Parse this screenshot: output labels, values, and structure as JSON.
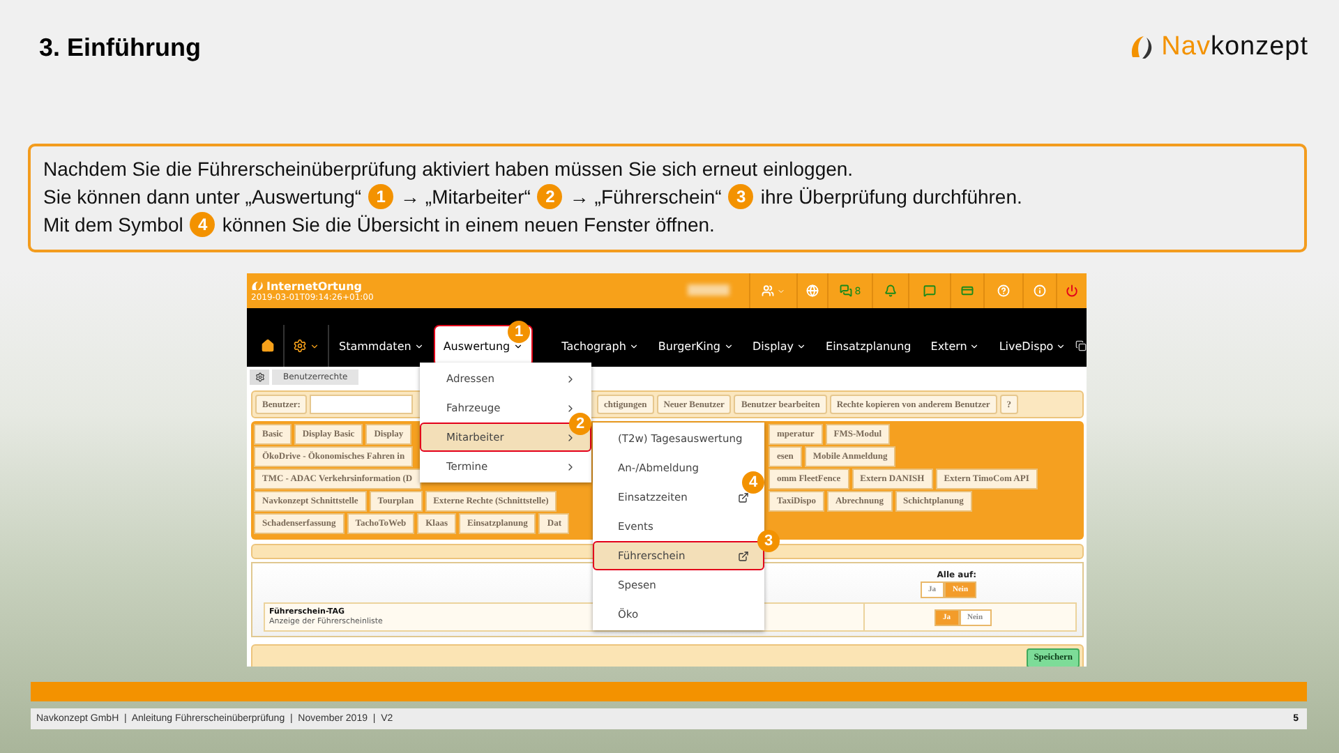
{
  "slide": {
    "title": "3. Einführung",
    "logo": {
      "prefix": "Nav",
      "suffix": "konzept"
    }
  },
  "instructions": [
    {
      "segments": [
        {
          "kind": "text",
          "text": "Nachdem Sie die Führerscheinüberprüfung aktiviert haben müssen Sie sich erneut einloggen."
        }
      ]
    },
    {
      "segments": [
        {
          "kind": "text",
          "text": "Sie können dann unter „Auswertung“"
        },
        {
          "kind": "badge",
          "text": "1"
        },
        {
          "kind": "text",
          "text": "→ „Mitarbeiter“"
        },
        {
          "kind": "badge",
          "text": "2"
        },
        {
          "kind": "text",
          "text": "→ „Führerschein“"
        },
        {
          "kind": "badge",
          "text": "3"
        },
        {
          "kind": "text",
          "text": "ihre Überprüfung durchführen."
        }
      ]
    },
    {
      "segments": [
        {
          "kind": "text",
          "text": "Mit dem Symbol"
        },
        {
          "kind": "badge",
          "text": "4"
        },
        {
          "kind": "text",
          "text": "können Sie die Übersicht in einem neuen Fenster öffnen."
        }
      ]
    }
  ],
  "app": {
    "brand": "InternetOrtung",
    "timestamp": "2019-03-01T09:14:26+01:00",
    "message_count": "8",
    "nav": [
      {
        "label": "Stammdaten",
        "caret": true,
        "selected": false
      },
      {
        "label": "Auswertung",
        "caret": true,
        "selected": true
      },
      {
        "label": "Tachograph",
        "caret": true,
        "selected": false
      },
      {
        "label": "BurgerKing",
        "caret": true,
        "selected": false
      },
      {
        "label": "Display",
        "caret": true,
        "selected": false
      },
      {
        "label": "Einsatzplanung",
        "caret": false,
        "selected": false
      },
      {
        "label": "Extern",
        "caret": true,
        "selected": false
      },
      {
        "label": "LiveDispo",
        "caret": true,
        "selected": false
      }
    ],
    "breadcrumb": "Benutzerrechte",
    "user_label": "Benutzer:",
    "user_actions": [
      "chtigungen",
      "Neuer Benutzer",
      "Benutzer bearbeiten",
      "Rechte kopieren von anderem Benutzer",
      "?"
    ],
    "tab_rows": [
      {
        "left": [
          "Basic",
          "Display Basic",
          "Display"
        ],
        "right": [
          "mperatur",
          "FMS-Modul"
        ]
      },
      {
        "left": [
          "ÖkoDrive - Ökonomisches Fahren in"
        ],
        "right": [
          "esen",
          "Mobile Anmeldung"
        ]
      },
      {
        "left": [
          "TMC - ADAC Verkehrsinformation (D"
        ],
        "right": [
          "omm FleetFence",
          "Extern DANISH",
          "Extern TimoCom API"
        ]
      },
      {
        "left": [
          "Navkonzept Schnittstelle",
          "Tourplan",
          "Externe Rechte (Schnittstelle)"
        ],
        "right": [
          "TaxiDispo",
          "Abrechnung",
          "Schichtplanung"
        ]
      },
      {
        "left": [
          "Schadenserfassung",
          "TachoToWeb",
          "Klaas",
          "Einsatzplanung",
          "Dat"
        ],
        "right": []
      }
    ],
    "bulk": {
      "label": "Alle auf:",
      "options": [
        {
          "label": "Ja",
          "selected": false
        },
        {
          "label": "Nein",
          "selected": true
        }
      ]
    },
    "permission": {
      "title": "Führerschein-TAG",
      "description": "Anzeige der Führerscheinliste",
      "options": [
        {
          "label": "Ja",
          "selected": true
        },
        {
          "label": "Nein",
          "selected": false
        }
      ]
    },
    "save": "Speichern",
    "menu": [
      {
        "label": "Adressen",
        "selected": false
      },
      {
        "label": "Fahrzeuge",
        "selected": false
      },
      {
        "label": "Mitarbeiter",
        "selected": true
      },
      {
        "label": "Termine",
        "selected": false
      }
    ],
    "submenu": [
      {
        "label": "(T2w) Tagesauswertung",
        "selected": false,
        "popout": false
      },
      {
        "label": "An-/Abmeldung",
        "selected": false,
        "popout": false
      },
      {
        "label": "Einsatzzeiten",
        "selected": false,
        "popout": true
      },
      {
        "label": "Events",
        "selected": false,
        "popout": false
      },
      {
        "label": "Führerschein",
        "selected": true,
        "popout": true
      },
      {
        "label": "Spesen",
        "selected": false,
        "popout": false
      },
      {
        "label": "Öko",
        "selected": false,
        "popout": false
      }
    ],
    "callouts": [
      "1",
      "2",
      "3",
      "4"
    ]
  },
  "footer": {
    "text": "Navkonzept GmbH  |  Anleitung Führerscheinüberprüfung  |  November 2019  |  V2",
    "page": "5"
  }
}
